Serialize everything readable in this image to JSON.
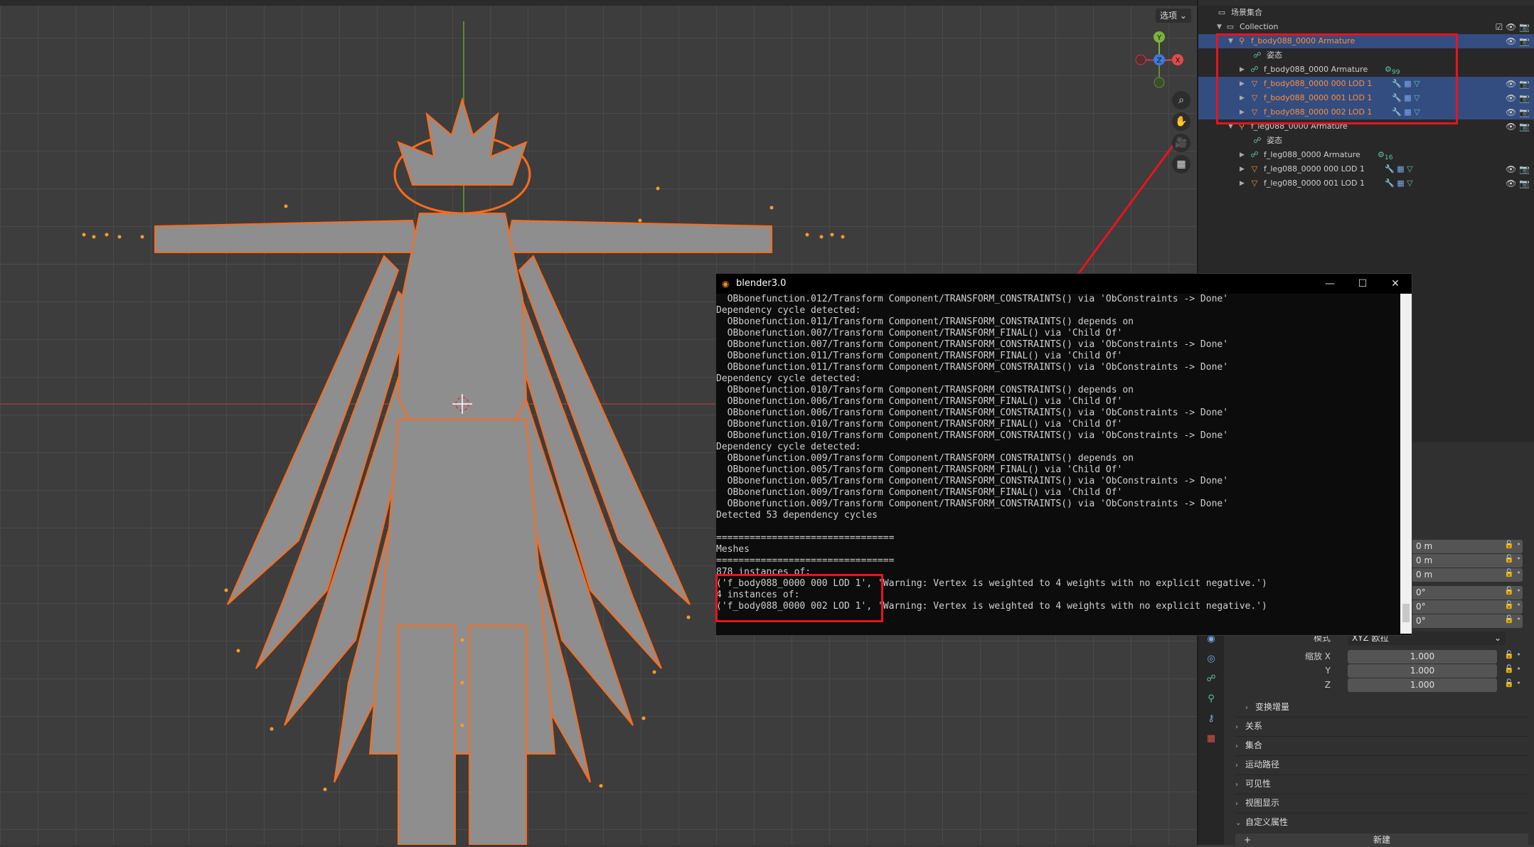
{
  "viewport": {
    "select_label": "选项 ⌄",
    "gizmo": {
      "x": "X",
      "y": "Y",
      "z": "Z"
    },
    "tools": [
      "zoom-icon",
      "hand-icon",
      "camera-icon",
      "grid-icon"
    ]
  },
  "outliner": {
    "title": "场景集合",
    "rows": [
      {
        "label": "Collection"
      },
      {
        "label": "f_body088_0000 Armature"
      },
      {
        "label": "姿态"
      },
      {
        "label": "f_body088_0000 Armature",
        "badge": "99"
      },
      {
        "label": "f_body088_0000 000 LOD 1"
      },
      {
        "label": "f_body088_0000 001 LOD 1"
      },
      {
        "label": "f_body088_0000 002 LOD 1"
      },
      {
        "label": "f_leg088_0000 Armature"
      },
      {
        "label": "姿态"
      },
      {
        "label": "f_leg088_0000 Armature",
        "badge": "16"
      },
      {
        "label": "f_leg088_0000 000 LOD 1"
      },
      {
        "label": "f_leg088_0000 001 LOD 1"
      }
    ]
  },
  "properties": {
    "location_values": [
      "0 m",
      "0 m",
      "0 m"
    ],
    "rotation_values": [
      "0°",
      "0°",
      "0°"
    ],
    "mode_label": "模式",
    "mode_value": "XYZ 欧拉",
    "scale_labels": [
      "缩放 X",
      "Y",
      "Z"
    ],
    "scale_values": [
      "1.000",
      "1.000",
      "1.000"
    ],
    "delta_transform": "变换增量",
    "panels": [
      "关系",
      "集合",
      "运动路径",
      "可见性",
      "视图显示",
      "自定义属性"
    ],
    "new_button": "新建"
  },
  "console": {
    "title": "blender3.0",
    "lines": [
      "  OBbonefunction.012/Transform Component/TRANSFORM_CONSTRAINTS() via 'ObConstraints -> Done'",
      "Dependency cycle detected:",
      "  OBbonefunction.011/Transform Component/TRANSFORM_CONSTRAINTS() depends on",
      "  OBbonefunction.007/Transform Component/TRANSFORM_FINAL() via 'Child Of'",
      "  OBbonefunction.007/Transform Component/TRANSFORM_CONSTRAINTS() via 'ObConstraints -> Done'",
      "  OBbonefunction.011/Transform Component/TRANSFORM_FINAL() via 'Child Of'",
      "  OBbonefunction.011/Transform Component/TRANSFORM_CONSTRAINTS() via 'ObConstraints -> Done'",
      "Dependency cycle detected:",
      "  OBbonefunction.010/Transform Component/TRANSFORM_CONSTRAINTS() depends on",
      "  OBbonefunction.006/Transform Component/TRANSFORM_FINAL() via 'Child Of'",
      "  OBbonefunction.006/Transform Component/TRANSFORM_CONSTRAINTS() via 'ObConstraints -> Done'",
      "  OBbonefunction.010/Transform Component/TRANSFORM_FINAL() via 'Child Of'",
      "  OBbonefunction.010/Transform Component/TRANSFORM_CONSTRAINTS() via 'ObConstraints -> Done'",
      "Dependency cycle detected:",
      "  OBbonefunction.009/Transform Component/TRANSFORM_CONSTRAINTS() depends on",
      "  OBbonefunction.005/Transform Component/TRANSFORM_FINAL() via 'Child Of'",
      "  OBbonefunction.005/Transform Component/TRANSFORM_CONSTRAINTS() via 'ObConstraints -> Done'",
      "  OBbonefunction.009/Transform Component/TRANSFORM_FINAL() via 'Child Of'",
      "  OBbonefunction.009/Transform Component/TRANSFORM_CONSTRAINTS() via 'ObConstraints -> Done'",
      "Detected 53 dependency cycles",
      "",
      "================================",
      "Meshes",
      "================================",
      "878 instances of:",
      "('f_body088_0000 000 LOD 1', 'Warning: Vertex is weighted to 4 weights with no explicit negative.')",
      "4 instances of:",
      "('f_body088_0000 002 LOD 1', 'Warning: Vertex is weighted to 4 weights with no explicit negative.')"
    ]
  },
  "colors": {
    "selection_outline": "#ff6a1a",
    "annotation_red": "#e8141e",
    "selected_row": "#334d80"
  }
}
